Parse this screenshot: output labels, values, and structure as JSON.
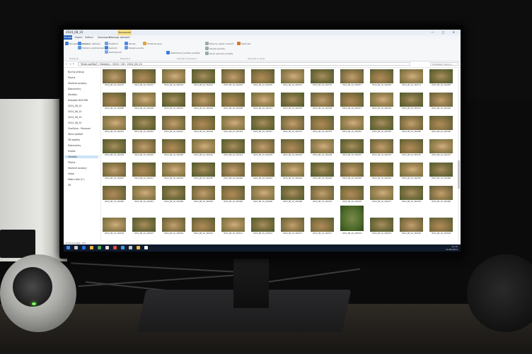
{
  "window": {
    "title": "2024_08_10",
    "context_tab": "Spravovat"
  },
  "ribbon_tabs": [
    "Soubor",
    "Domů",
    "Sdílení",
    "Zobrazení",
    "Nástroje obrázků"
  ],
  "ribbon": {
    "items": [
      "Navigační podokno",
      "Podokno náhledu",
      "Podokno podrobností",
      "Dlaždice",
      "Seznam",
      "Podrobnosti",
      "Obsah",
      "Skupina podle",
      "Přidat sloupce",
      "Zaškrtávací políčka položek",
      "Přípony názvů souborů",
      "Skryté položky",
      "Skrýt vybrané položky",
      "Možnosti"
    ],
    "groups": [
      "Podokna",
      "Rozložení",
      "Aktuální zobrazení",
      "Zobrazit či skrýt"
    ]
  },
  "address": {
    "path": "Tento počítač  ›  Obrázky  ›  2024  ›  08  ›  2024_08_10",
    "search_placeholder": "Prohledat: 2024_0..."
  },
  "nav": {
    "items": [
      "Rychlý přístup",
      "Plocha",
      "Stažené soubory",
      "Dokumenty",
      "Obrázky",
      "Jednotka DVD RW",
      "2024_08_10",
      "2024_08_10",
      "2024_08_10",
      "2024_08_10",
      "OneDrive - Personal",
      "Tento počítač",
      "3D objekty",
      "Dokumenty",
      "Hudba",
      "Obrázky",
      "Plocha",
      "Stažené soubory",
      "Videa",
      "Místní disk (C:)",
      "Síť"
    ],
    "selected_index": 15
  },
  "thumbnails": {
    "captions": [
      [
        "2024_08_10_162221",
        "2024_08_10_162222",
        "2024_08_10_162224",
        "2024_08_10_162243",
        "2024_08_10_162244",
        "2024_08_10_162245",
        "2024_08_10_162251",
        "2024_08_10_162252",
        "2024_08_10_162257",
        "2024_08_10_162264",
        "2024_08_10_162271",
        "2024_08_10_162283"
      ],
      [
        "2024_08_10_162285",
        "2024_08_10_162290",
        "2024_08_10_162291",
        "2024_08_10_162294",
        "2024_08_10_162296",
        "2024_08_10_162311",
        "2024_08_10_162325",
        "2024_08_10_162326",
        "2024_08_10_162327",
        "2024_08_10_162329",
        "2024_08_10_162331",
        "2024_08_10_162340"
      ],
      [
        "2024_08_10_162342",
        "2024_08_10_162343",
        "2024_08_10_162347",
        "2024_08_10_162349",
        "2024_08_10_162353",
        "2024_08_10_162357",
        "2024_08_10_162370",
        "2024_08_10_162378",
        "2024_08_10_162381",
        "2024_08_10_162393",
        "2024_08_10_162395",
        "2024_08_10_162396"
      ],
      [
        "2024_08_10_162400",
        "2024_08_10_162403",
        "2024_08_10_162405",
        "2024_08_10_162410",
        "2024_08_10_162412",
        "2024_08_10_162418",
        "2024_08_10_162420",
        "2024_08_10_162428",
        "2024_08_10_162431",
        "2024_08_10_162433",
        "2024_08_10_162470",
        "2024_08_10_162475"
      ],
      [
        "2024_08_10_162467",
        "2024_08_10_162471",
        "2024_08_10_162432",
        "2024_08_10_162435",
        "2024_08_10_162440",
        "2024_08_10_162443",
        "2024_08_10_162444",
        "2024_08_10_162446",
        "2024_08_10_162450",
        "2024_08_10_162452",
        "2024_08_10_162455",
        "2024_08_10_162480"
      ],
      [
        "2024_08_10_162485",
        "2024_08_10_162487",
        "2024_08_10_162489",
        "2024_08_10_162493",
        "2024_08_10_162495",
        "2024_08_10_162496",
        "2024_08_10_162468",
        "2024_08_10_162470",
        "2024_08_10_162476",
        "2024_08_10_162477",
        "2024_08_10_162478",
        "2024_08_10_162480"
      ],
      [
        "2024_08_10_162504",
        "2024_08_10_162507",
        "2024_08_10_162509",
        "2024_08_10_162510",
        "2024_08_10_162511",
        "2024_08_10_162512",
        "2024_08_10_162513",
        "2024_08_10_162517",
        "2024_08_10_162519",
        "2024_08_10_162523",
        "2024_08_10_162526",
        "2024_08_10_162528"
      ]
    ]
  },
  "status": {
    "count": "Počet položek: 251"
  },
  "taskbar": {
    "time": "21:10",
    "date": "10.08.2024"
  },
  "colors": {
    "taskbar": "#0f1a2c",
    "selection": "#cce4f7",
    "led": "#7cff5a"
  }
}
